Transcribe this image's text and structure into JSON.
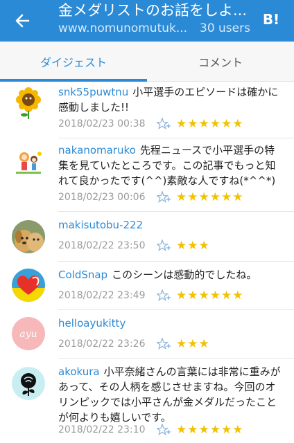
{
  "header": {
    "title": "金メダリストのお話をしよ...",
    "url": "www.nomunomutuk...",
    "users": "30 users",
    "hatena_label": "B!",
    "colors": {
      "bar": "#2b8ad6",
      "text": "#ffffff"
    }
  },
  "tabs": [
    {
      "label": "ダイジェスト",
      "active": true
    },
    {
      "label": "コメント",
      "active": false
    }
  ],
  "accent_color": "#2b8ad6",
  "star_color": "#f2c200",
  "comments": [
    {
      "user": "snk55puwtnu",
      "text": "小平選手のエピソードは確かに感動しました!!",
      "date": "2018/02/23 00:38",
      "star_count": 6,
      "stars": "★★★★★★",
      "avatar_icon": "sunflower-avatar"
    },
    {
      "user": "nakanomaruko",
      "text": "先程ニュースで小平選手の特集を見ていたところです。この記事でもっと知れて良かったです(^^)素敵な人ですね(*^^*)",
      "date": "2018/02/23 00:06",
      "star_count": 6,
      "stars": "★★★★★★",
      "avatar_icon": "kids-drawing-avatar"
    },
    {
      "user": "makisutobu-222",
      "text": "",
      "date": "2018/02/22 23:50",
      "star_count": 3,
      "stars": "★★★",
      "avatar_icon": "dog-avatar"
    },
    {
      "user": "ColdSnap",
      "text": "このシーンは感動的でしたね。",
      "date": "2018/02/22 23:49",
      "star_count": 6,
      "stars": "★★★★★★",
      "avatar_icon": "heart-avatar"
    },
    {
      "user": "helloayukitty",
      "text": "",
      "date": "2018/02/22 23:26",
      "star_count": 3,
      "stars": "★★★",
      "avatar_icon": "pink-script-avatar",
      "avatar_text": "ayu"
    },
    {
      "user": "akokura",
      "text": "小平奈緒さんの言葉には非常に重みがあって、その人柄を感じさせますね。今回のオリンピックでは小平さんが金メダルだったことが何よりも嬉しいです。",
      "date": "2018/02/22 23:10",
      "star_count": 6,
      "stars": "★★★★★★",
      "avatar_icon": "rose-avatar"
    }
  ]
}
